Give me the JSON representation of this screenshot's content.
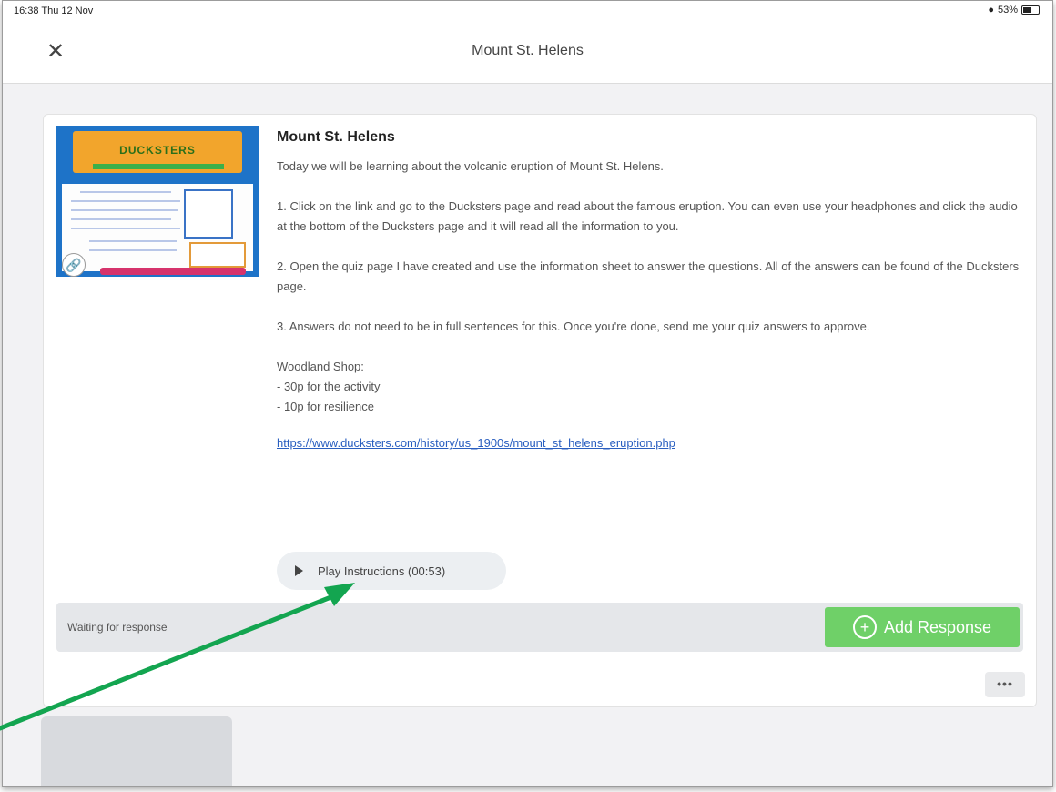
{
  "status_bar": {
    "time": "16:38  Thu 12 Nov",
    "battery": "53%"
  },
  "nav": {
    "close_icon": "close-icon",
    "title": "Mount St. Helens"
  },
  "thumbnail": {
    "logo_text": "DUCKSTERS",
    "link_icon": "link-icon"
  },
  "activity": {
    "title": "Mount St. Helens",
    "intro": "Today we will be learning about the volcanic eruption of Mount St. Helens.",
    "step1": "1. Click on the link and go to the Ducksters page and read about the famous eruption. You can even use your headphones and click the audio at the bottom of the Ducksters page and it will read all the information to you.",
    "step2": "2. Open the quiz page I have created and use the information sheet to answer the questions. All of the answers can be found of the Ducksters page.",
    "step3": "3. Answers do not need to be in full sentences for this. Once you're done, send me your quiz answers to approve.",
    "shop_heading": "Woodland Shop:",
    "shop_items": [
      "- 30p for the activity",
      "- 10p for resilience"
    ],
    "url": "https://www.ducksters.com/history/us_1900s/mount_st_helens_eruption.php",
    "play_label": "Play Instructions (00:53)"
  },
  "response": {
    "status": "Waiting for response",
    "add_label": "Add Response",
    "more_label": "•••"
  },
  "colors": {
    "accent_green": "#6fd068",
    "link_blue": "#2a5fc0",
    "annotation_arrow": "#13a550"
  }
}
